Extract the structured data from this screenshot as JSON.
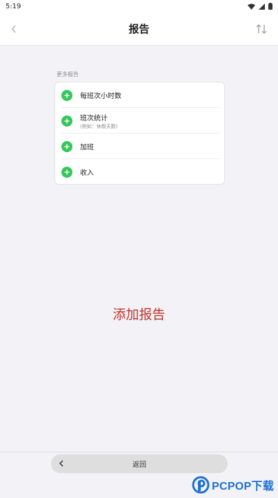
{
  "status_bar": {
    "time": "5:19"
  },
  "header": {
    "title": "报告"
  },
  "section": {
    "label": "更多报告"
  },
  "report_options": [
    {
      "label": "每班次小时数",
      "sub": ""
    },
    {
      "label": "班次统计",
      "sub": "(例如：休假天数)"
    },
    {
      "label": "加班",
      "sub": ""
    },
    {
      "label": "收入",
      "sub": ""
    }
  ],
  "empty_state": {
    "text": "添加报告"
  },
  "bottom": {
    "back_label": "返回"
  },
  "watermark": {
    "text": "PCPOP下载"
  },
  "colors": {
    "accent_green": "#34c759",
    "add_report_red": "#c2312b"
  }
}
